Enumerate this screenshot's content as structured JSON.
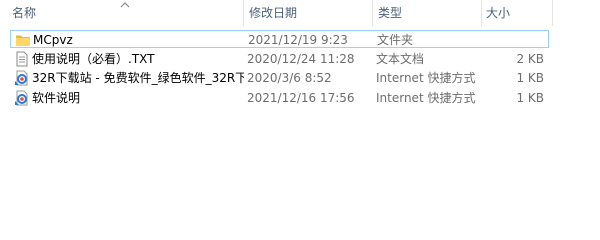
{
  "columns": {
    "name": "名称",
    "date": "修改日期",
    "type": "类型",
    "size": "大小"
  },
  "files": [
    {
      "name": "MCpvz",
      "date": "2021/12/19 9:23",
      "type": "文件夹",
      "size": "",
      "icon": "folder-icon",
      "selected": true
    },
    {
      "name": "使用说明（必看）.TXT",
      "date": "2020/12/24 11:28",
      "type": "文本文档",
      "size": "2 KB",
      "icon": "text-file-icon",
      "selected": false
    },
    {
      "name": "32R下载站 - 免费软件_绿色软件_32R下...",
      "date": "2020/3/6 8:52",
      "type": "Internet 快捷方式",
      "size": "1 KB",
      "icon": "internet-shortcut-icon",
      "selected": false
    },
    {
      "name": "软件说明",
      "date": "2021/12/16 17:56",
      "type": "Internet 快捷方式",
      "size": "1 KB",
      "icon": "internet-shortcut-icon",
      "selected": false
    }
  ]
}
